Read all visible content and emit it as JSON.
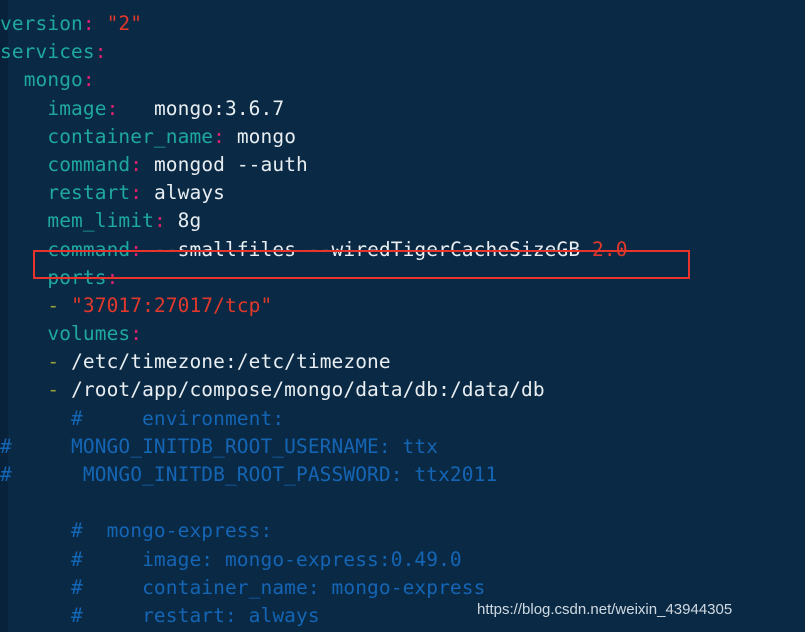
{
  "editor": {
    "language": "yaml",
    "background_color": "#0a2944",
    "gutter_color": "#07223a",
    "colors": {
      "key": "#1fa8a0",
      "colon": "#e0216f",
      "value": "#e8eef2",
      "string": "#e0392c",
      "dash": "#9aa037",
      "comment": "#1565b5",
      "annotation_box": "#e8342a"
    }
  },
  "code_lines": [
    {
      "id": "line-1",
      "text": "version: \"2\""
    },
    {
      "id": "line-2",
      "text": "services:"
    },
    {
      "id": "line-3",
      "text": "  mongo:"
    },
    {
      "id": "line-4",
      "text": "    image:   mongo:3.6.7"
    },
    {
      "id": "line-5",
      "text": "    container_name: mongo"
    },
    {
      "id": "line-6",
      "text": "    command: mongod --auth"
    },
    {
      "id": "line-7",
      "text": "    restart: always"
    },
    {
      "id": "line-8",
      "text": "    mem_limit: 8g"
    },
    {
      "id": "line-9",
      "text": "    command: --smallfiles --wiredTigerCacheSizeGB 2.0"
    },
    {
      "id": "line-10",
      "text": "    ports:"
    },
    {
      "id": "line-11",
      "text": "    - \"37017:27017/tcp\""
    },
    {
      "id": "line-12",
      "text": "    volumes:"
    },
    {
      "id": "line-13",
      "text": "    - /etc/timezone:/etc/timezone"
    },
    {
      "id": "line-14",
      "text": "    - /root/app/compose/mongo/data/db:/data/db"
    },
    {
      "id": "line-15",
      "text": "      #     environment:"
    },
    {
      "id": "line-16",
      "text": "#     MONGO_INITDB_ROOT_USERNAME: ttx"
    },
    {
      "id": "line-17",
      "text": "#      MONGO_INITDB_ROOT_PASSWORD: ttx2011"
    },
    {
      "id": "line-18",
      "text": ""
    },
    {
      "id": "line-19",
      "text": "      #  mongo-express:"
    },
    {
      "id": "line-20",
      "text": "      #     image: mongo-express:0.49.0"
    },
    {
      "id": "line-21",
      "text": "      #     container_name: mongo-express"
    },
    {
      "id": "line-22",
      "text": "      #     restart: always"
    }
  ],
  "rendered_lines": [
    {
      "indent": "",
      "segments": [
        {
          "t": "version",
          "c": "tok-key"
        },
        {
          "t": ":",
          "c": "tok-colon"
        },
        {
          "t": " ",
          "c": "tok-plain"
        },
        {
          "t": "\"2\"",
          "c": "tok-str"
        }
      ]
    },
    {
      "indent": "",
      "segments": [
        {
          "t": "services",
          "c": "tok-key"
        },
        {
          "t": ":",
          "c": "tok-colon"
        }
      ]
    },
    {
      "indent": "  ",
      "segments": [
        {
          "t": "mongo",
          "c": "tok-key"
        },
        {
          "t": ":",
          "c": "tok-colon"
        }
      ]
    },
    {
      "indent": "    ",
      "segments": [
        {
          "t": "image",
          "c": "tok-key"
        },
        {
          "t": ":",
          "c": "tok-colon"
        },
        {
          "t": "   ",
          "c": "tok-plain"
        },
        {
          "t": "mongo:3.6.7",
          "c": "tok-val"
        }
      ]
    },
    {
      "indent": "    ",
      "segments": [
        {
          "t": "container_name",
          "c": "tok-key"
        },
        {
          "t": ":",
          "c": "tok-colon"
        },
        {
          "t": " ",
          "c": "tok-plain"
        },
        {
          "t": "mongo",
          "c": "tok-val"
        }
      ]
    },
    {
      "indent": "    ",
      "segments": [
        {
          "t": "command",
          "c": "tok-key"
        },
        {
          "t": ":",
          "c": "tok-colon"
        },
        {
          "t": " ",
          "c": "tok-plain"
        },
        {
          "t": "mongod --auth",
          "c": "tok-val"
        }
      ]
    },
    {
      "indent": "    ",
      "segments": [
        {
          "t": "restart",
          "c": "tok-key"
        },
        {
          "t": ":",
          "c": "tok-colon"
        },
        {
          "t": " ",
          "c": "tok-plain"
        },
        {
          "t": "always",
          "c": "tok-val"
        }
      ]
    },
    {
      "indent": "    ",
      "segments": [
        {
          "t": "mem_limit",
          "c": "tok-key"
        },
        {
          "t": ":",
          "c": "tok-colon"
        },
        {
          "t": " ",
          "c": "tok-plain"
        },
        {
          "t": "8g",
          "c": "tok-val"
        }
      ]
    },
    {
      "indent": "    ",
      "segments": [
        {
          "t": "command",
          "c": "tok-key"
        },
        {
          "t": ":",
          "c": "tok-colon"
        },
        {
          "t": " ",
          "c": "tok-plain"
        },
        {
          "t": "--smallfiles --wiredTigerCacheSizeGB ",
          "c": "tok-val"
        },
        {
          "t": "2.0",
          "c": "tok-num"
        }
      ]
    },
    {
      "indent": "    ",
      "segments": [
        {
          "t": "ports",
          "c": "tok-key"
        },
        {
          "t": ":",
          "c": "tok-colon"
        }
      ]
    },
    {
      "indent": "    ",
      "segments": [
        {
          "t": "-",
          "c": "tok-dash"
        },
        {
          "t": " ",
          "c": "tok-plain"
        },
        {
          "t": "\"37017:27017/tcp\"",
          "c": "tok-str"
        }
      ]
    },
    {
      "indent": "    ",
      "segments": [
        {
          "t": "volumes",
          "c": "tok-key"
        },
        {
          "t": ":",
          "c": "tok-colon"
        }
      ]
    },
    {
      "indent": "    ",
      "segments": [
        {
          "t": "-",
          "c": "tok-dash"
        },
        {
          "t": " ",
          "c": "tok-plain"
        },
        {
          "t": "/etc/timezone:/etc/timezone",
          "c": "tok-val"
        }
      ]
    },
    {
      "indent": "    ",
      "segments": [
        {
          "t": "-",
          "c": "tok-dash"
        },
        {
          "t": " ",
          "c": "tok-plain"
        },
        {
          "t": "/root/app/compose/mongo/data/db:/data/db",
          "c": "tok-val"
        }
      ]
    },
    {
      "indent": "      ",
      "segments": [
        {
          "t": "#     environment:",
          "c": "tok-comment"
        }
      ]
    },
    {
      "indent": "",
      "segments": [
        {
          "t": "#     MONGO_INITDB_ROOT_USERNAME: ttx",
          "c": "tok-comment"
        }
      ]
    },
    {
      "indent": "",
      "segments": [
        {
          "t": "#      MONGO_INITDB_ROOT_PASSWORD: ttx2011",
          "c": "tok-comment"
        }
      ]
    },
    {
      "indent": "",
      "segments": [
        {
          "t": " ",
          "c": "tok-plain"
        }
      ]
    },
    {
      "indent": "      ",
      "segments": [
        {
          "t": "#  mongo-express:",
          "c": "tok-comment"
        }
      ]
    },
    {
      "indent": "      ",
      "segments": [
        {
          "t": "#     image: mongo-express:0.49.0",
          "c": "tok-comment"
        }
      ]
    },
    {
      "indent": "      ",
      "segments": [
        {
          "t": "#     container_name: mongo-express",
          "c": "tok-comment"
        }
      ]
    },
    {
      "indent": "      ",
      "segments": [
        {
          "t": "#     restart: always",
          "c": "tok-comment"
        }
      ]
    }
  ],
  "annotation": {
    "type": "red-rectangle-highlight",
    "target_line_id": "line-9",
    "target_text": "command: --smallfiles --wiredTigerCacheSizeGB 2.0"
  },
  "watermark": {
    "text": "https://blog.csdn.net/weixin_43944305"
  }
}
